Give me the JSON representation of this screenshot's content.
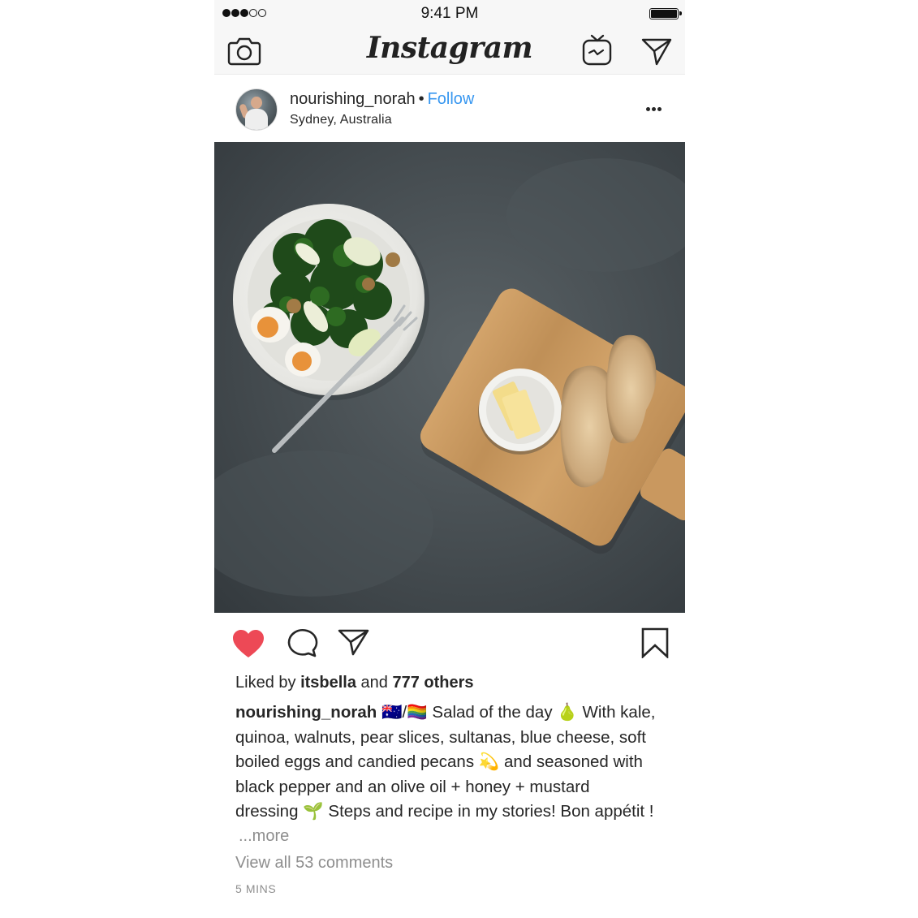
{
  "status_bar": {
    "time": "9:41 PM",
    "signal_bars_filled": 3,
    "signal_bars_total": 5
  },
  "nav": {
    "logo": "Instagram",
    "left_icon": "camera-icon",
    "right_icons": [
      "igtv-icon",
      "direct-message-icon"
    ]
  },
  "post": {
    "username": "nourishing_norah",
    "separator": "•",
    "follow_label": "Follow",
    "location": "Sydney, Australia",
    "menu_icon": "more-options-icon",
    "photo_description_icon": "post-photo"
  },
  "actions": {
    "liked": true,
    "icons": [
      "heart-icon",
      "comment-icon",
      "share-icon",
      "bookmark-icon"
    ]
  },
  "likes": {
    "prefix": "Liked by ",
    "user": "itsbella",
    "middle": " and ",
    "others": "777 others"
  },
  "caption": {
    "user": "nourishing_norah",
    "flags": "🇦🇺/🏳️‍🌈",
    "line1": " Salad of the day 🍐 With kale,",
    "line2": "quinoa, walnuts, pear slices, sultanas, blue cheese, soft",
    "line3": "boiled eggs and candied pecans 💫 and seasoned with",
    "line4": "black pepper and an olive oil + honey + mustard",
    "line5": "dressing 🌱 Steps and recipe in my stories! Bon appétit !"
  },
  "more_label": "...more",
  "comments_label": "View all 53 comments",
  "timestamp": "5 MINS",
  "colors": {
    "follow": "#3897f0",
    "heart": "#ed4956",
    "muted": "#8e8e8e",
    "bar_bg": "#f7f7f7"
  }
}
